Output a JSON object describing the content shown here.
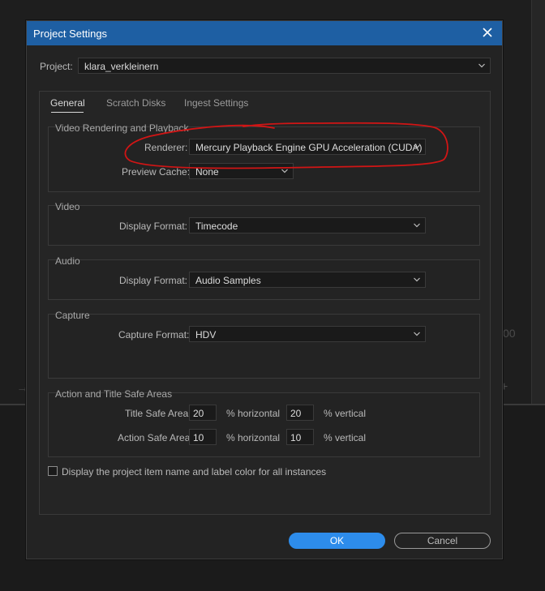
{
  "dialog": {
    "title": "Project Settings",
    "close_icon": "close-icon"
  },
  "project": {
    "label": "Project:",
    "value": "klara_verkleinern"
  },
  "tabs": [
    {
      "label": "General",
      "active": true
    },
    {
      "label": "Scratch Disks",
      "active": false
    },
    {
      "label": "Ingest Settings",
      "active": false
    }
  ],
  "video_rendering": {
    "title": "Video Rendering and Playback",
    "renderer_label": "Renderer:",
    "renderer_value": "Mercury Playback Engine GPU Acceleration (CUDA)",
    "preview_cache_label": "Preview Cache:",
    "preview_cache_value": "None"
  },
  "video": {
    "title": "Video",
    "display_format_label": "Display Format:",
    "display_format_value": "Timecode"
  },
  "audio": {
    "title": "Audio",
    "display_format_label": "Display Format:",
    "display_format_value": "Audio Samples"
  },
  "capture": {
    "title": "Capture",
    "capture_format_label": "Capture Format:",
    "capture_format_value": "HDV"
  },
  "safe_areas": {
    "title": "Action and Title Safe Areas",
    "title_safe_label": "Title Safe Area",
    "title_safe_h": "20",
    "title_safe_v": "20",
    "action_safe_label": "Action Safe Area",
    "action_safe_h": "10",
    "action_safe_v": "10",
    "horizontal_label": "% horizontal",
    "vertical_label": "% vertical"
  },
  "display_option": {
    "label": "Display the project item name and label color for all instances",
    "checked": false
  },
  "buttons": {
    "ok": "OK",
    "cancel": "Cancel"
  },
  "colors": {
    "titlebar": "#1e5fa3",
    "accent_button": "#2d8ceb",
    "annotation": "#d11515"
  },
  "background": {
    "right_edge_glyph": "00"
  }
}
